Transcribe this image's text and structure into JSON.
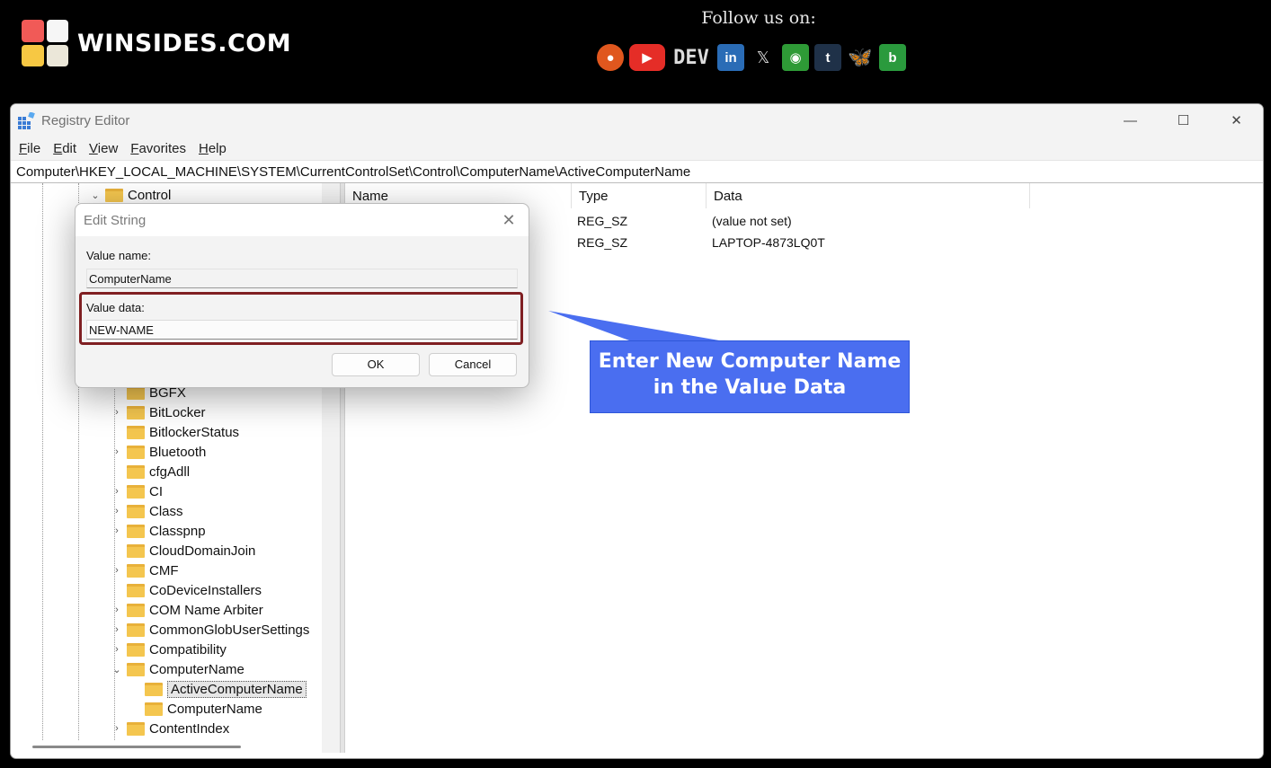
{
  "banner": {
    "brand": "WINSIDES.COM",
    "follow_text": "Follow us on:",
    "socials": [
      {
        "name": "reddit-icon",
        "glyph": "●",
        "color": "#e0571e"
      },
      {
        "name": "youtube-icon",
        "glyph": "▶",
        "color": "#e52d27"
      },
      {
        "name": "dev-icon",
        "glyph": "DEV",
        "color": "transparent"
      },
      {
        "name": "linkedin-icon",
        "glyph": "in",
        "color": "#2a6cb6"
      },
      {
        "name": "x-icon",
        "glyph": "𝕏",
        "color": "transparent"
      },
      {
        "name": "site-icon",
        "glyph": "◉",
        "color": "#2e9a36"
      },
      {
        "name": "tumblr-icon",
        "glyph": "t",
        "color": "#1f3148"
      },
      {
        "name": "bluesky-icon",
        "glyph": "🦋",
        "color": "transparent"
      },
      {
        "name": "blogger-icon",
        "glyph": "b",
        "color": "#2a9a3d"
      }
    ],
    "logo_colors": [
      "#f15a57",
      "#f6f6f6",
      "#f7c843",
      "#ebe7d9"
    ]
  },
  "window": {
    "title": "Registry Editor",
    "controls": {
      "minimize": "—",
      "maximize": "☐",
      "close": "✕"
    },
    "menu": [
      {
        "key": "F",
        "rest": "ile"
      },
      {
        "key": "E",
        "rest": "dit"
      },
      {
        "key": "V",
        "rest": "iew"
      },
      {
        "key": "F",
        "rest": "avorites",
        "prefix": ""
      },
      {
        "key": "H",
        "rest": "elp"
      }
    ],
    "address": "Computer\\HKEY_LOCAL_MACHINE\\SYSTEM\\CurrentControlSet\\Control\\ComputerName\\ActiveComputerName"
  },
  "tree": [
    {
      "label": "Control",
      "expander": "⌄",
      "indent": 0
    },
    {
      "label": "BGFX",
      "expander": "",
      "indent": 1
    },
    {
      "label": "BitLocker",
      "expander": "›",
      "indent": 1
    },
    {
      "label": "BitlockerStatus",
      "expander": "",
      "indent": 1
    },
    {
      "label": "Bluetooth",
      "expander": "›",
      "indent": 1
    },
    {
      "label": "cfgAdll",
      "expander": "",
      "indent": 1
    },
    {
      "label": "CI",
      "expander": "›",
      "indent": 1
    },
    {
      "label": "Class",
      "expander": "›",
      "indent": 1
    },
    {
      "label": "Classpnp",
      "expander": "›",
      "indent": 1
    },
    {
      "label": "CloudDomainJoin",
      "expander": "",
      "indent": 1
    },
    {
      "label": "CMF",
      "expander": "›",
      "indent": 1
    },
    {
      "label": "CoDeviceInstallers",
      "expander": "",
      "indent": 1
    },
    {
      "label": "COM Name Arbiter",
      "expander": "›",
      "indent": 1
    },
    {
      "label": "CommonGlobUserSettings",
      "expander": "›",
      "indent": 1
    },
    {
      "label": "Compatibility",
      "expander": "›",
      "indent": 1
    },
    {
      "label": "ComputerName",
      "expander": "⌄",
      "indent": 1
    },
    {
      "label": "ActiveComputerName",
      "expander": "",
      "indent": 2,
      "selected": true
    },
    {
      "label": "ComputerName",
      "expander": "",
      "indent": 2
    },
    {
      "label": "ContentIndex",
      "expander": "›",
      "indent": 1
    }
  ],
  "list": {
    "columns": [
      "Name",
      "Type",
      "Data"
    ],
    "rows": [
      {
        "type": "REG_SZ",
        "data": "(value not set)"
      },
      {
        "type": "REG_SZ",
        "data": "LAPTOP-4873LQ0T"
      }
    ]
  },
  "dialog": {
    "title": "Edit String",
    "value_name_label": "Value name:",
    "value_name": "ComputerName",
    "value_data_label": "Value data:",
    "value_data": "NEW-NAME",
    "ok": "OK",
    "cancel": "Cancel"
  },
  "callout": {
    "line1": "Enter New Computer Name",
    "line2": "in the Value Data",
    "color": "#4a6ef0"
  }
}
